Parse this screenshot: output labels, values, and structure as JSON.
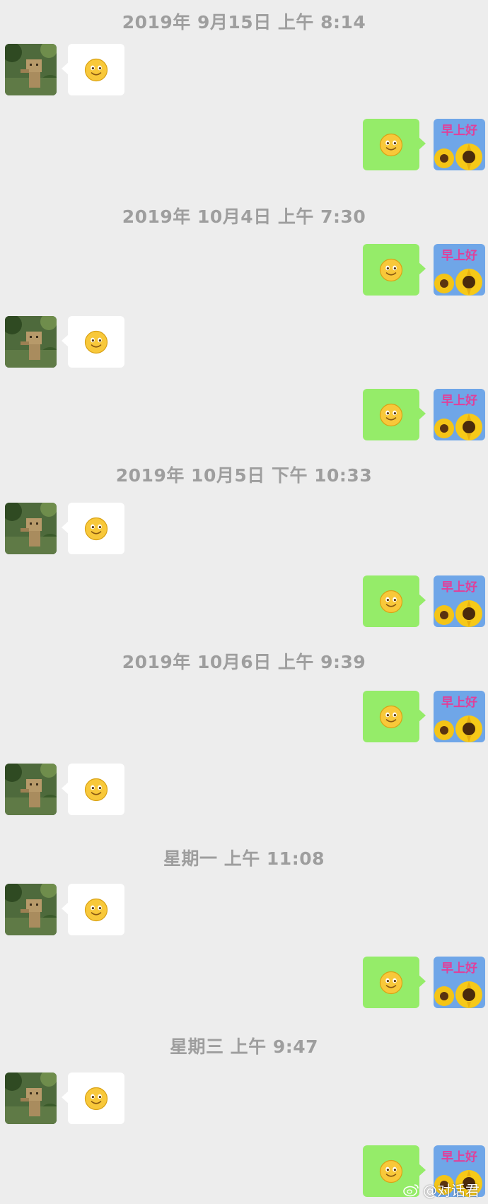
{
  "timestamps": [
    "2019年 9月15日 上午 8:14",
    "2019年 10月4日 上午 7:30",
    "2019年 10月5日 下午 10:33",
    "2019年 10月6日 上午 9:39",
    "星期一 上午 11:08",
    "星期三 上午 9:47"
  ],
  "messages": [
    {
      "direction": "incoming",
      "content": "smiley-emoji"
    },
    {
      "direction": "outgoing",
      "content": "smiley-emoji"
    },
    {
      "direction": "outgoing",
      "content": "smiley-emoji"
    },
    {
      "direction": "incoming",
      "content": "smiley-emoji"
    },
    {
      "direction": "outgoing",
      "content": "smiley-emoji"
    },
    {
      "direction": "incoming",
      "content": "smiley-emoji"
    },
    {
      "direction": "outgoing",
      "content": "smiley-emoji"
    },
    {
      "direction": "outgoing",
      "content": "smiley-emoji"
    },
    {
      "direction": "incoming",
      "content": "smiley-emoji"
    },
    {
      "direction": "incoming",
      "content": "smiley-emoji"
    },
    {
      "direction": "outgoing",
      "content": "smiley-emoji"
    },
    {
      "direction": "incoming",
      "content": "smiley-emoji"
    },
    {
      "direction": "outgoing",
      "content": "smiley-emoji"
    }
  ],
  "outgoing_avatar_text": "早上好",
  "watermark": {
    "icon": "weibo-icon",
    "text": "@对话君"
  },
  "colors": {
    "background": "#ededed",
    "incoming_bubble": "#ffffff",
    "outgoing_bubble": "#95ec69",
    "timestamp_text": "#9e9e9e",
    "outgoing_avatar_bg": "#6fa6e8"
  }
}
